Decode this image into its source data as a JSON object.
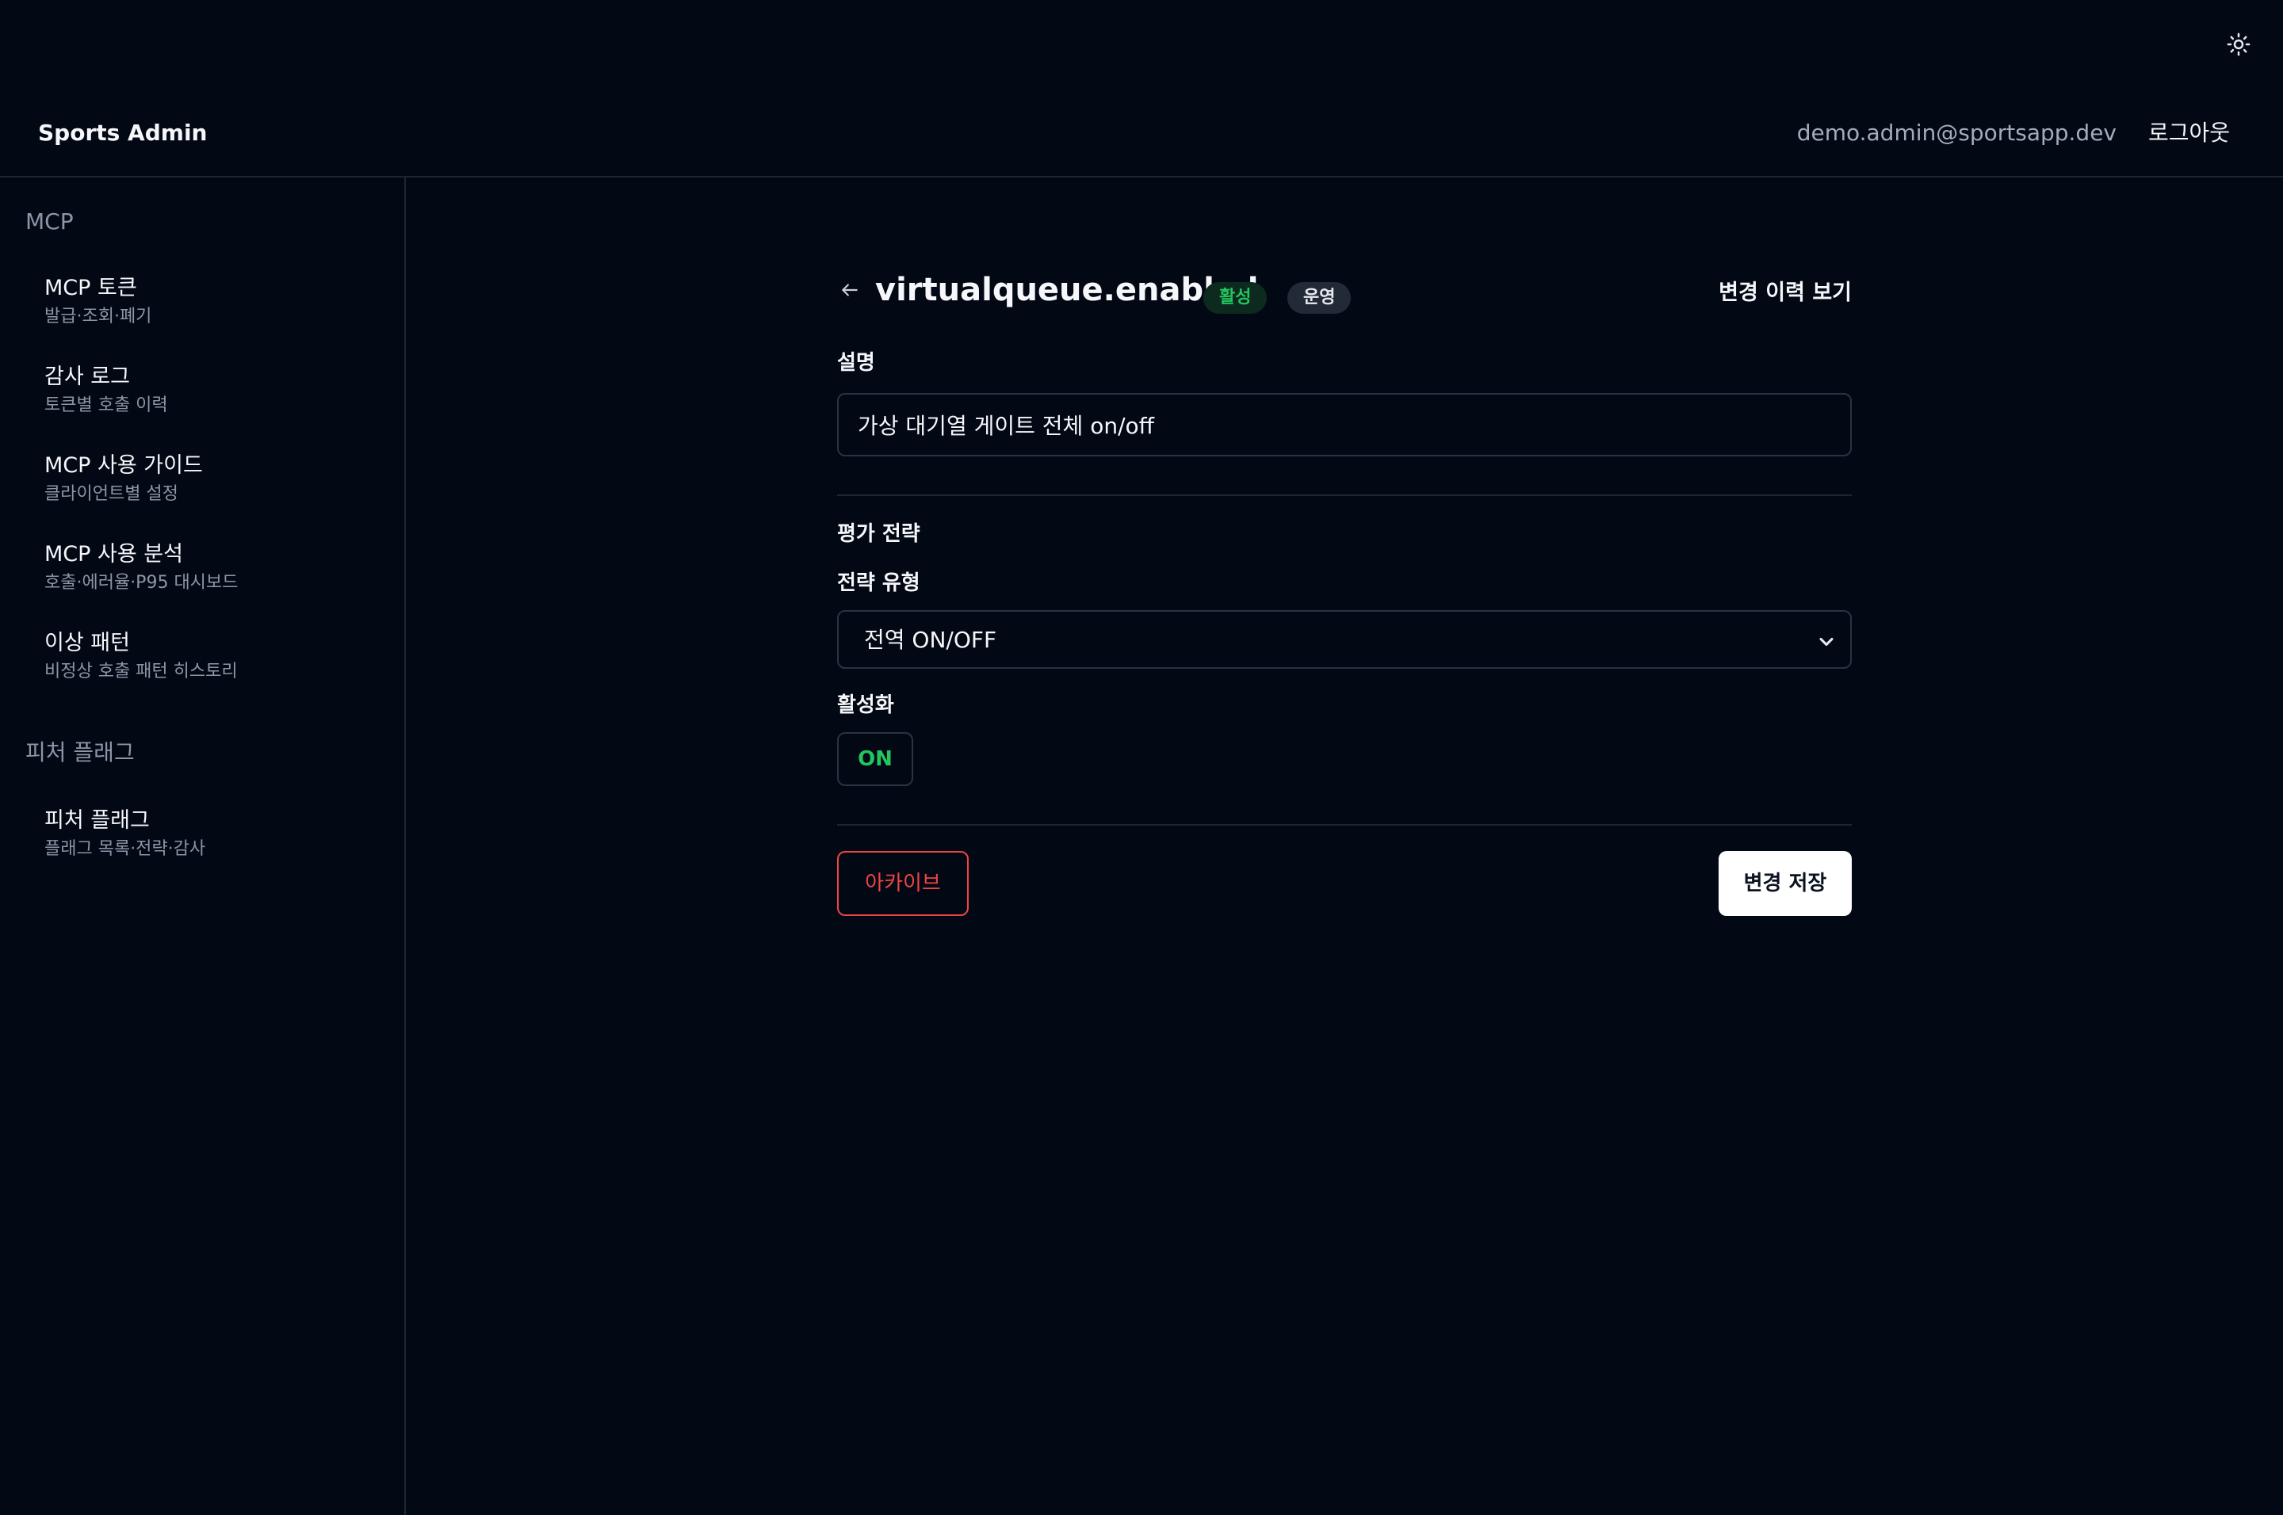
{
  "header": {
    "brand": "Sports Admin",
    "user_email": "demo.admin@sportsapp.dev",
    "logout_label": "로그아웃",
    "theme_icon": "sun-icon"
  },
  "sidebar": {
    "groups": [
      {
        "title": "MCP",
        "items": [
          {
            "title": "MCP 토큰",
            "subtitle": "발급·조회·폐기"
          },
          {
            "title": "감사 로그",
            "subtitle": "토큰별 호출 이력"
          },
          {
            "title": "MCP 사용 가이드",
            "subtitle": "클라이언트별 설정"
          },
          {
            "title": "MCP 사용 분석",
            "subtitle": "호출·에러율·P95 대시보드"
          },
          {
            "title": "이상 패턴",
            "subtitle": "비정상 호출 패턴 히스토리"
          }
        ]
      },
      {
        "title": "피처 플래그",
        "items": [
          {
            "title": "피처 플래그",
            "subtitle": "플래그 목록·전략·감사"
          }
        ]
      }
    ]
  },
  "flag": {
    "key": "virtualqueue.enabled",
    "status_badge": "활성",
    "env_badge": "운영",
    "history_link": "변경 이력 보기",
    "description_label": "설명",
    "description_value": "가상 대기열 게이트 전체 on/off",
    "strategy_section_title": "평가 전략",
    "strategy_type_label": "전략 유형",
    "strategy_type_value": "전역 ON/OFF",
    "enabled_label": "활성화",
    "enabled_value": "ON",
    "archive_label": "아카이브",
    "save_label": "변경 저장"
  },
  "colors": {
    "background": "#030815",
    "border": "#1e2533",
    "success": "#22c55e",
    "danger": "#ef4444",
    "muted_text": "#8c95a6"
  }
}
